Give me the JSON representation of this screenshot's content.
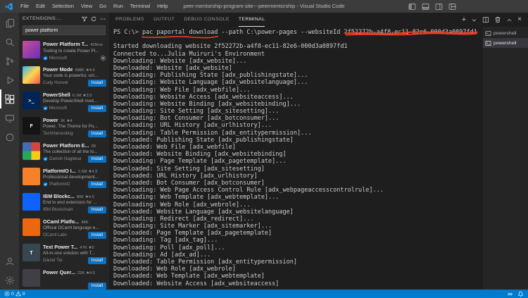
{
  "colors": {
    "status_bar": "#007acc",
    "install_button": "#0e70c0",
    "annotation_red": "#e8402a",
    "verified_badge": "#0078d4"
  },
  "title_bar": {
    "menus": [
      "File",
      "Edit",
      "Selection",
      "View",
      "Go",
      "Run",
      "Terminal",
      "Help"
    ],
    "title": "peer-mentorship-program-site---peermentorship - Visual Studio Code"
  },
  "sidebar": {
    "header": "EXTENSIONS:...",
    "search_value": "power platform",
    "install_label": "Install",
    "extensions": [
      {
        "name": "Power Platform T...",
        "badge": "428ms",
        "downloads": "",
        "rating": "",
        "desc": "Tooling to create Power Pl...",
        "publisher": "Microsoft",
        "verified": true,
        "action": "gear",
        "icon_bg": "linear-gradient(135deg,#c94f9b,#6b2fb3)",
        "icon_glyph": ""
      },
      {
        "name": "Power Mode",
        "downloads": "588K",
        "rating": "4.5",
        "desc": "Your code is powerful, unl...",
        "publisher": "Cody Hoover",
        "verified": false,
        "action": "install",
        "icon_bg": "linear-gradient(135deg,#29b6f6,#ffd54f,#ef5350)",
        "icon_glyph": ""
      },
      {
        "name": "PowerShell",
        "downloads": "6.1M",
        "rating": "3.5",
        "desc": "Develop PowerShell mod...",
        "publisher": "Microsoft",
        "verified": true,
        "action": "install",
        "icon_bg": "#012456",
        "icon_glyph": ">_"
      },
      {
        "name": "Power",
        "downloads": "1K",
        "rating": "4",
        "desc": "Power. The Theme for Po...",
        "publisher": "TechHarvesting",
        "verified": false,
        "action": "install",
        "icon_bg": "#141414",
        "icon_glyph": "P"
      },
      {
        "name": "Power Platform E...",
        "downloads": "2K",
        "rating": "",
        "desc": "The collection of all the to...",
        "publisher": "Danish Naglekar",
        "verified": true,
        "action": "install",
        "icon_bg": "conic-gradient(#d64541 0deg 90deg,#f7ca18 90deg 180deg,#26a65b 180deg 270deg,#446cb3 270deg 360deg)",
        "icon_glyph": ""
      },
      {
        "name": "PlatformIO I...",
        "downloads": "2.5M",
        "rating": "4.5",
        "desc": "Professional development...",
        "publisher": "PlatformIO",
        "verified": true,
        "action": "install",
        "icon_bg": "#f5822a",
        "icon_glyph": ""
      },
      {
        "name": "IBM Blockc...",
        "downloads": "86K",
        "rating": "4.5",
        "desc": "End to end extension for ...",
        "publisher": "IBM Blockchain",
        "verified": false,
        "action": "install",
        "icon_bg": "#0f62fe",
        "icon_glyph": ""
      },
      {
        "name": "OCaml Platfo...",
        "downloads": "48K",
        "rating": "",
        "desc": "Official OCaml language e...",
        "publisher": "OCaml Labs",
        "verified": false,
        "action": "install",
        "icon_bg": "#ec670f",
        "icon_glyph": ""
      },
      {
        "name": "Text Power T...",
        "downloads": "47K",
        "rating": "5",
        "desc": "All-in-one solution with T...",
        "publisher": "Dániel Tar",
        "verified": false,
        "action": "install",
        "icon_bg": "#37474f",
        "icon_glyph": "T"
      },
      {
        "name": "Power Quer...",
        "downloads": "22K",
        "rating": "4.5",
        "desc": "",
        "publisher": "",
        "verified": false,
        "action": "install",
        "icon_bg": "#3f3f46",
        "icon_glyph": ""
      }
    ]
  },
  "panel": {
    "tabs": [
      "PROBLEMS",
      "OUTPUT",
      "DEBUG CONSOLE",
      "TERMINAL"
    ],
    "active_tab": "TERMINAL",
    "terminal": {
      "prompt": "PS C:\\> ",
      "command": "pac paportal download",
      "args": " --path C:\\power-pages --websiteId ",
      "website_id": "2f52272b-a4f8-ec11-82e6-000d3a0897fd1",
      "lines": [
        "",
        "Started downloading website 2f52272b-a4f8-ec11-82e6-000d3a0897fd1",
        "Connected to...Julia Muiruri's Environment",
        "Downloading: Website [adx_website]...",
        "Downloaded: Website [adx_website]",
        "Downloading: Publishing State [adx_publishingstate]...",
        "Downloading: Website Language [adx_websitelanguage]...",
        "Downloading: Web File [adx_webfile]...",
        "Downloading: Website Access [adx_websiteaccess]...",
        "Downloading: Website Binding [adx_websitebinding]...",
        "Downloading: Site Setting [adx_sitesetting]...",
        "Downloading: Bot Consumer [adx_botconsumer]...",
        "Downloading: URL History [adx_urlhistory]...",
        "Downloading: Table Permission [adx_entitypermission]...",
        "Downloaded: Publishing State [adx_publishingstate]",
        "Downloaded: Web File [adx_webfile]",
        "Downloaded: Website Binding [adx_websitebinding]",
        "Downloading: Page Template [adx_pagetemplate]...",
        "Downloaded: Site Setting [adx_sitesetting]",
        "Downloaded: URL History [adx_urlhistory]",
        "Downloaded: Bot Consumer [adx_botconsumer]",
        "Downloading: Web Page Access Control Rule [adx_webpageaccesscontrolrule]...",
        "Downloading: Web Template [adx_webtemplate]...",
        "Downloading: Web Role [adx_webrole]...",
        "Downloaded: Website Language [adx_websitelanguage]",
        "Downloading: Redirect [adx_redirect]...",
        "Downloading: Site Marker [adx_sitemarker]...",
        "Downloaded: Page Template [adx_pagetemplate]",
        "Downloading: Tag [adx_tag]...",
        "Downloading: Poll [adx_poll]...",
        "Downloading: Ad [adx_ad]...",
        "Downloaded: Table Permission [adx_entitypermission]",
        "Downloaded: Web Role [adx_webrole]",
        "Downloaded: Web Template [adx_webtemplate]",
        "Downloaded: Website Access [adx_websiteaccess]"
      ]
    },
    "terminal_list": [
      {
        "label": "powershell",
        "active": false
      },
      {
        "label": "powershell",
        "active": true
      }
    ]
  },
  "status_bar": {
    "errors": "0",
    "warnings": "0"
  }
}
